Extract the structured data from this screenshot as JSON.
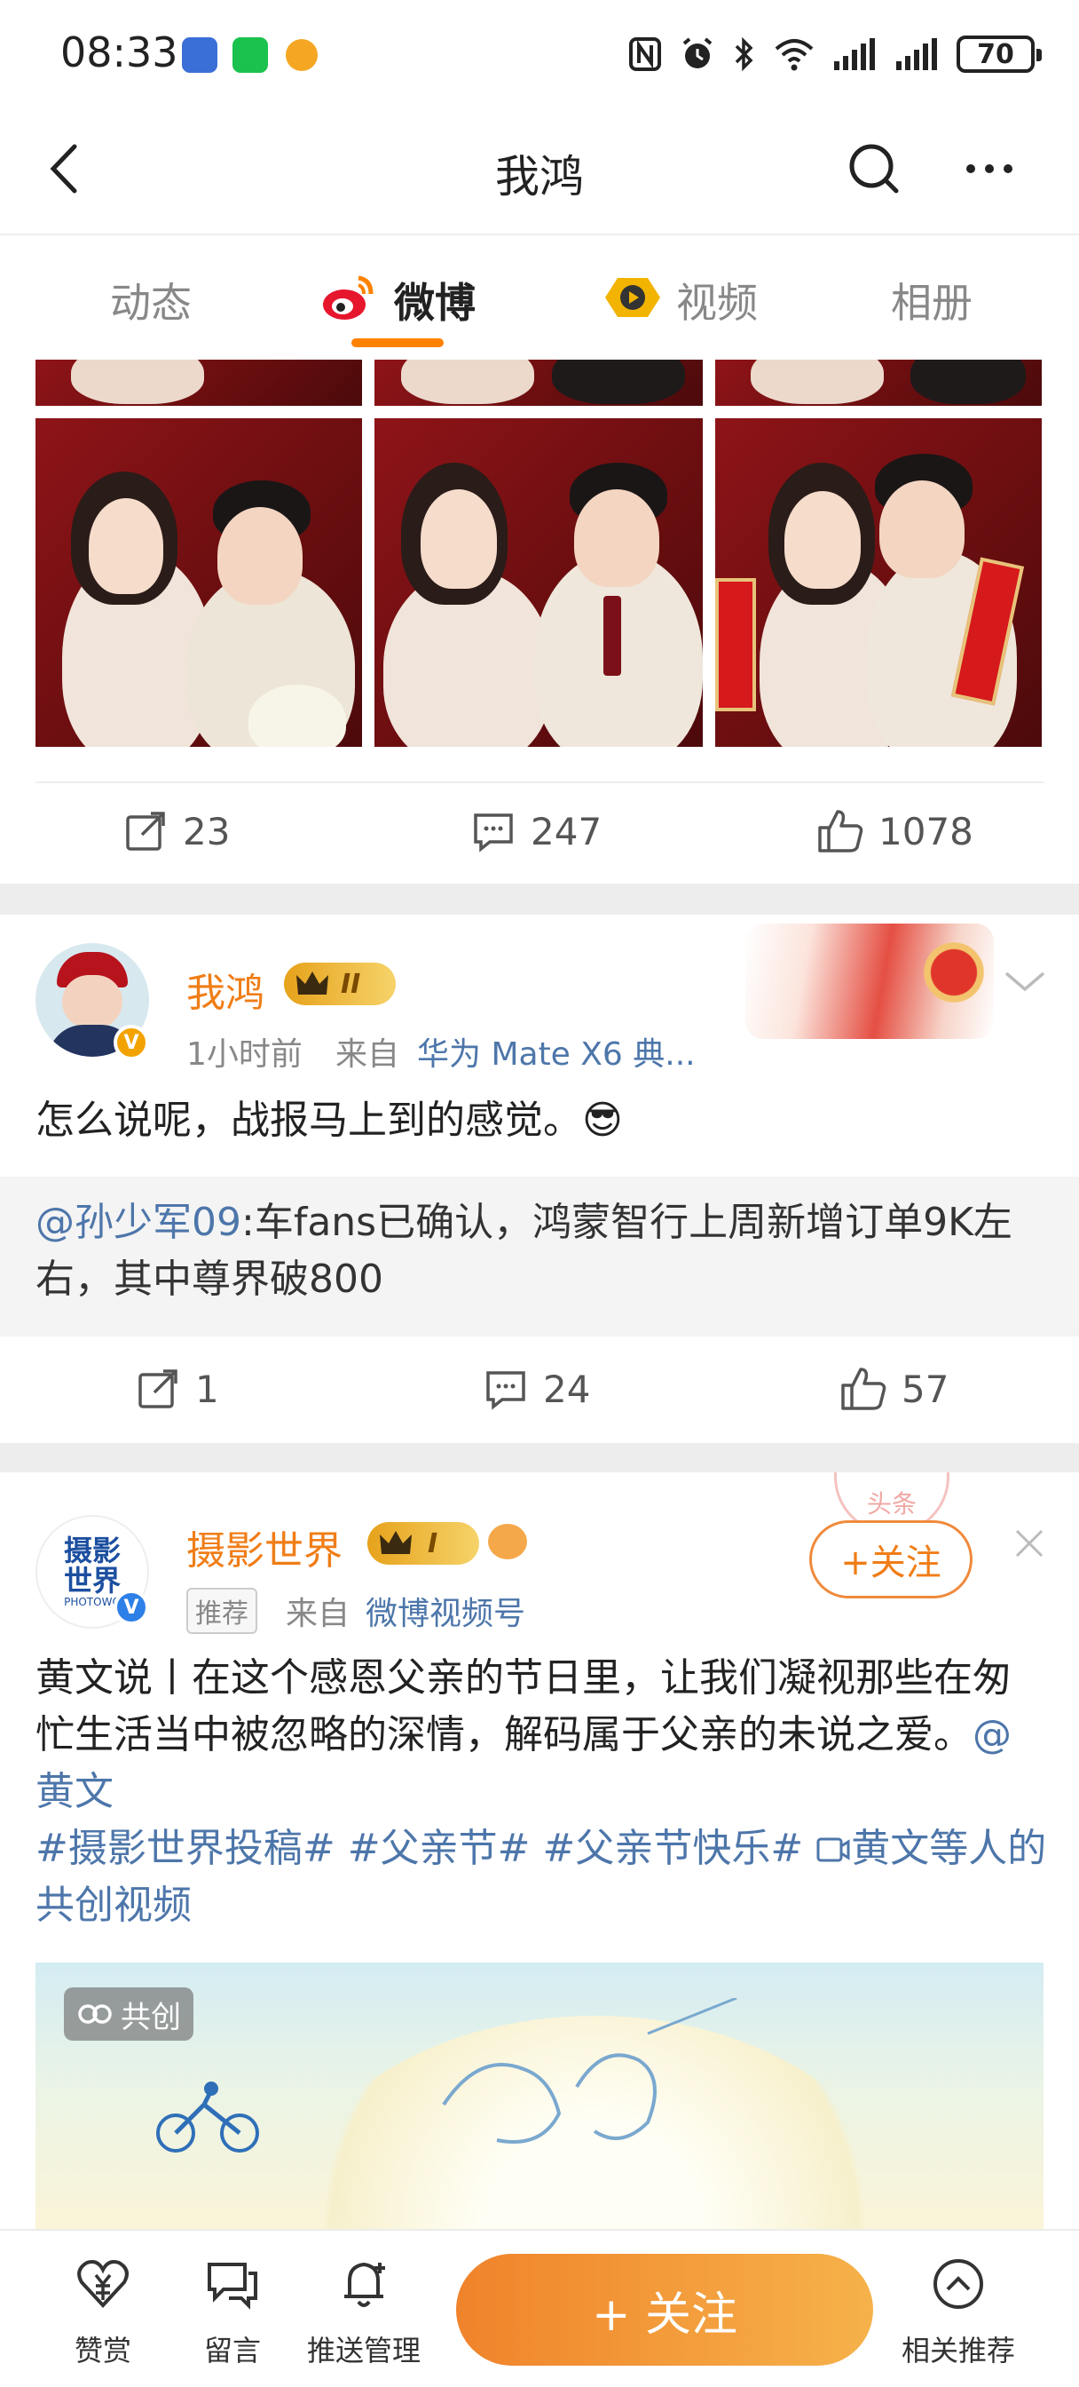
{
  "status_bar": {
    "time": "08:33",
    "battery": "70"
  },
  "nav": {
    "title": "我鸿"
  },
  "tabs": [
    {
      "label": "动态"
    },
    {
      "label": "微博"
    },
    {
      "label": "视频"
    },
    {
      "label": "相册"
    }
  ],
  "post1": {
    "stats": {
      "reposts": "23",
      "comments": "247",
      "likes": "1078"
    }
  },
  "post2": {
    "author": "我鸿",
    "level_badge": "II",
    "time": "1小时前",
    "source_prefix": "来自",
    "source": "华为 Mate X6 典...",
    "text": "怎么说呢，战报马上到的感觉。😎",
    "quote_mention": "@孙少军09",
    "quote_text": ":车fans已确认，鸿蒙智行上周新增订单9K左右，其中尊界破800",
    "stats": {
      "reposts": "1",
      "comments": "24",
      "likes": "57"
    }
  },
  "post3": {
    "author": "摄影世界",
    "level_badge": "I",
    "avatar_text": "摄影\n世界",
    "avatar_sub": "PHOTOWO",
    "recommend_tag": "推荐",
    "source_prefix": "来自",
    "source": "微博视频号",
    "follow_label": "+关注",
    "text_main": "黄文说丨在这个感恩父亲的节日里，让我们凝视那些在匆忙生活当中被忽略的深情，解码属于父亲的未说之爱。",
    "mention": "@黄文",
    "hashtags": [
      "#摄影世界投稿#",
      "#父亲节#",
      "#父亲节快乐#"
    ],
    "cocreate_link": "黄文等人的共创视频",
    "video_badge": "共创"
  },
  "stamp_text": "头条",
  "bottom_bar": {
    "items": [
      {
        "label": "赞赏",
        "icon": "tip-heart-icon"
      },
      {
        "label": "留言",
        "icon": "message-icon"
      },
      {
        "label": "推送管理",
        "icon": "bell-icon"
      }
    ],
    "follow_label": "+ 关注",
    "related_label": "相关推荐"
  },
  "colors": {
    "accent": "#f07d16",
    "link": "#4d76aa",
    "brand_orange": "#ff8200"
  }
}
